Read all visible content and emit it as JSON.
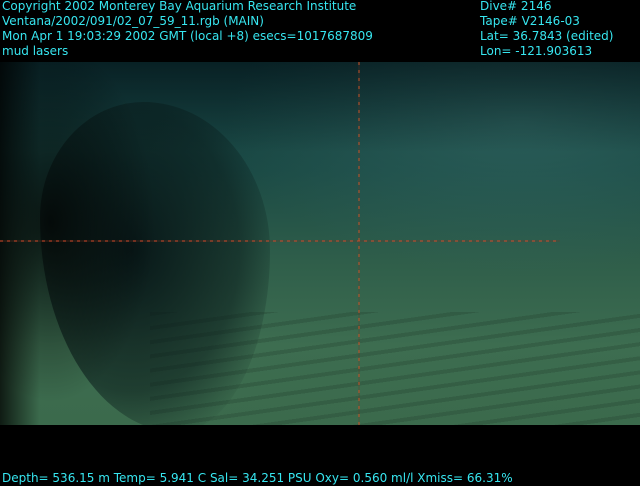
{
  "overlay": {
    "top_left": [
      "Copyright 2002 Monterey Bay Aquarium Research Institute",
      "Ventana/2002/091/02_07_59_11.rgb (MAIN)",
      "Mon Apr  1 19:03:29 2002 GMT (local +8)  esecs=1017687809",
      "mud lasers"
    ],
    "top_right": [
      "Dive# 2146",
      "Tape# V2146-03",
      "Lat= 36.7843 (edited)",
      "Lon= -121.903613"
    ],
    "bottom": "Depth= 536.15 m  Temp= 5.941 C  Sal= 34.251 PSU  Oxy= 0.560 ml/l  Xmiss= 66.31%"
  },
  "colors": {
    "overlay_text": "#37e6f0",
    "background": "#000000",
    "laser": "#c84628"
  }
}
